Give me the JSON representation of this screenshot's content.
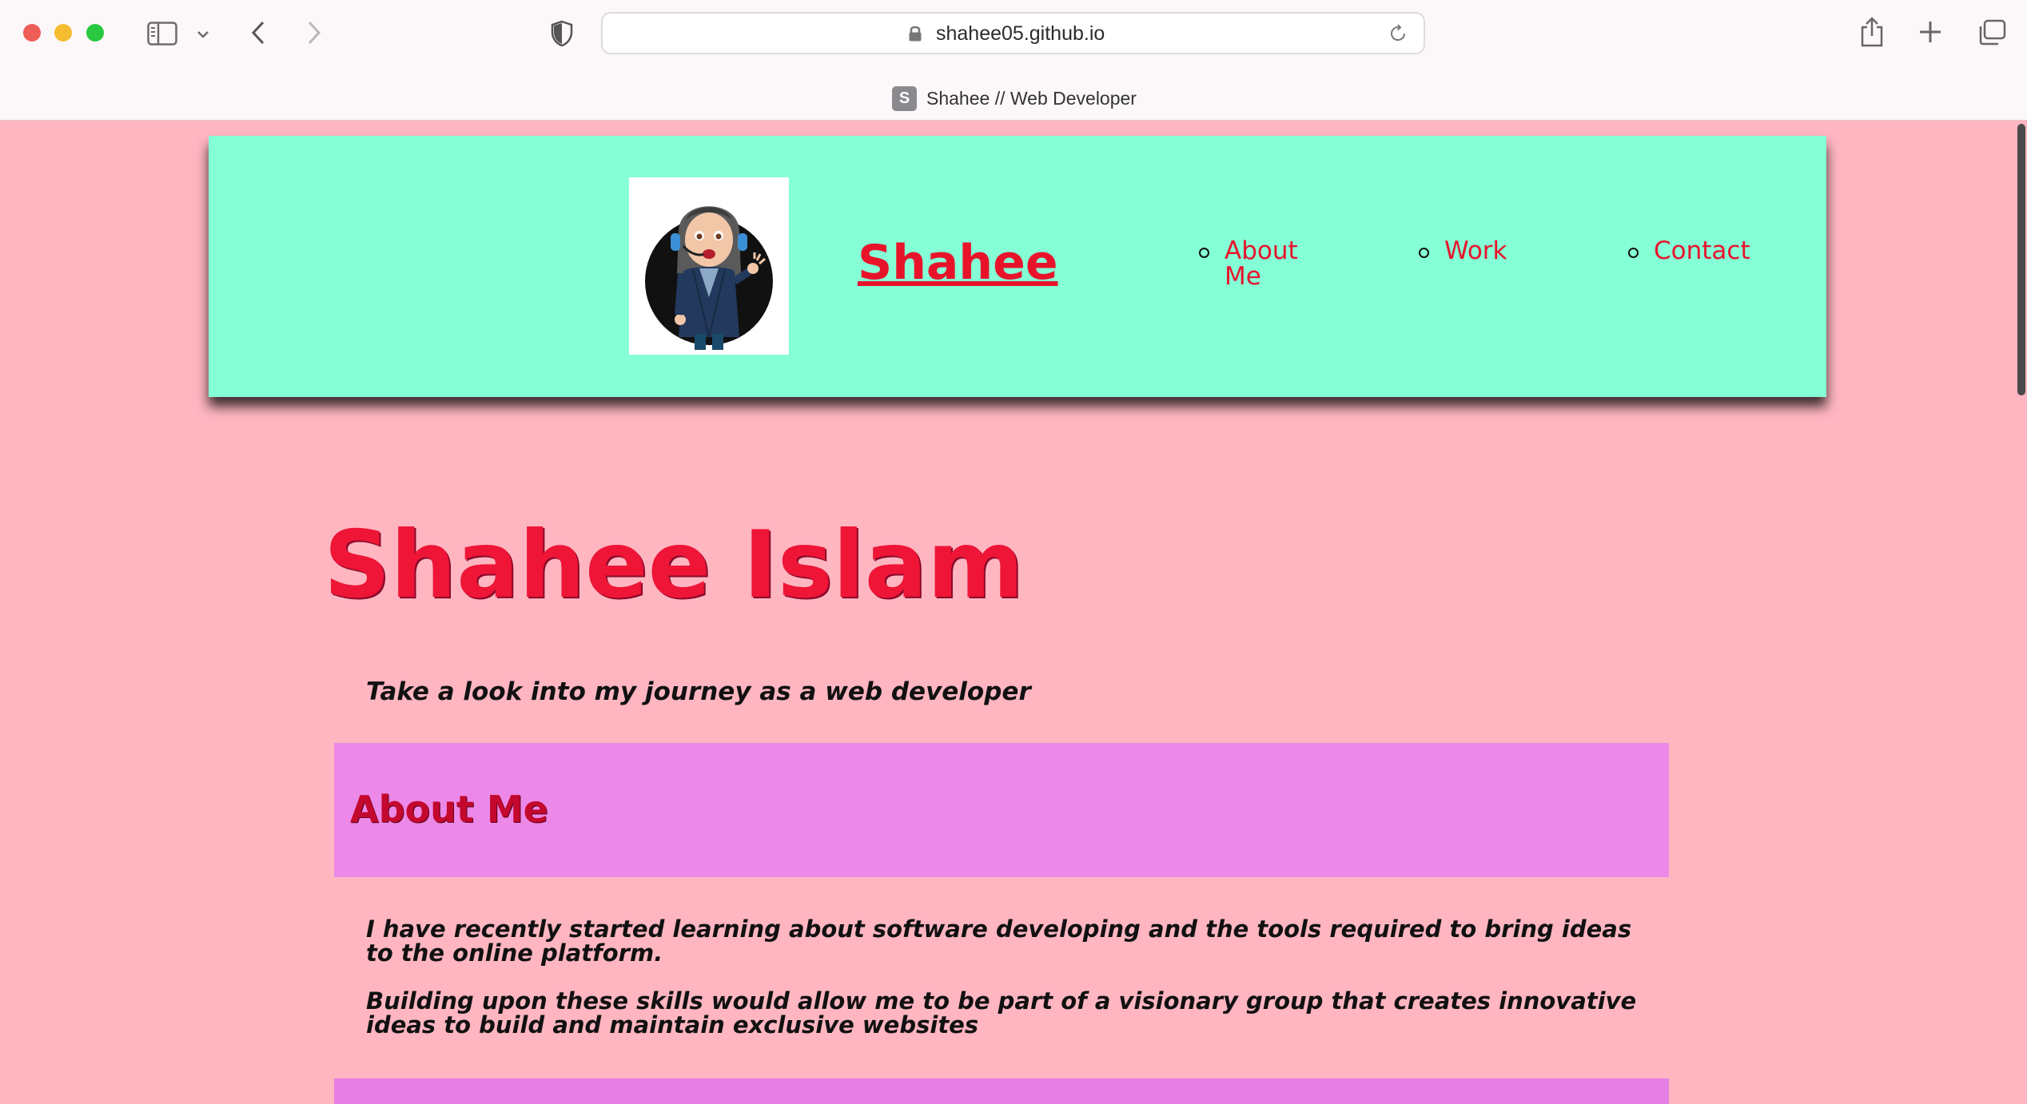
{
  "browser": {
    "url": "shahee05.github.io",
    "tab_title": "Shahee // Web Developer",
    "tab_favicon_letter": "S"
  },
  "header": {
    "brand": "Shahee",
    "avatar_alt": "avatar",
    "nav": [
      {
        "label": "About Me"
      },
      {
        "label": "Work"
      },
      {
        "label": "Contact"
      }
    ]
  },
  "hero": {
    "title": "Shahee Islam",
    "tagline": "Take a look into my journey as a web developer"
  },
  "about": {
    "heading": "About Me",
    "paragraphs": [
      "I have recently started learning about software developing and the tools required to bring ideas to the online platform.",
      "Building upon these skills would allow me to be part of a visionary group that creates innovative ideas to build and maintain exclusive websites"
    ]
  },
  "colors": {
    "page_background": "#ffb6c1",
    "header_background": "#85ffd6",
    "accent_red": "#e8132b",
    "section_bar": "#ec89e8"
  }
}
